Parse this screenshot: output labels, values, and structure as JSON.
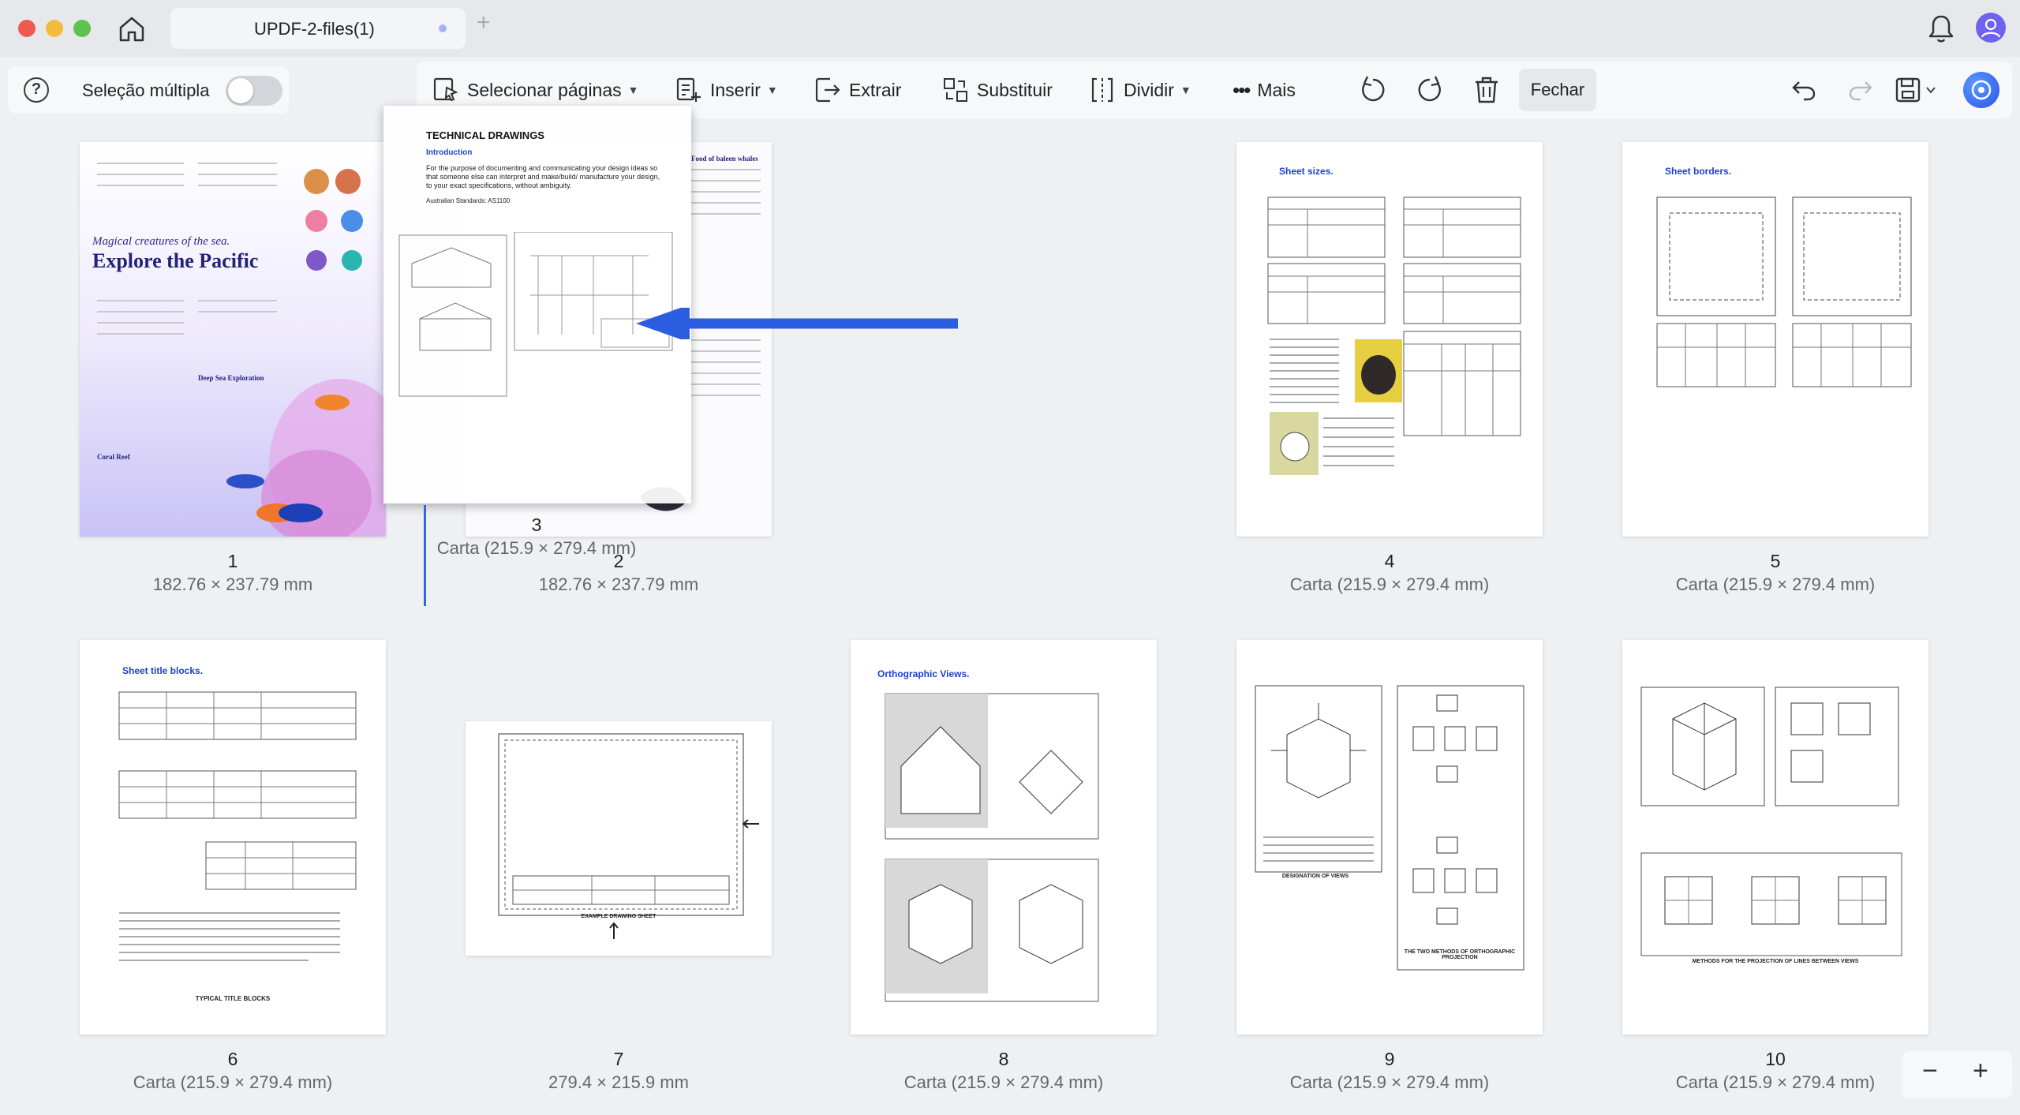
{
  "window": {
    "tab_title": "UPDF-2-files(1)",
    "tab_add": "+"
  },
  "left_panel": {
    "help": "?",
    "multi_select_label": "Seleção múltipla",
    "multi_select_on": false
  },
  "toolbar": {
    "select_pages": "Selecionar páginas",
    "insert": "Inserir",
    "extract": "Extrair",
    "replace": "Substituir",
    "split": "Dividir",
    "more": "Mais",
    "close": "Fechar"
  },
  "zoom": {
    "out": "−",
    "in": "+"
  },
  "pages": [
    {
      "num": "1",
      "size": "182.76 × 237.79 mm"
    },
    {
      "num": "2",
      "size": "182.76 × 237.79 mm"
    },
    {
      "num": "3",
      "size": "Carta (215.9 × 279.4 mm)"
    },
    {
      "num": "4",
      "size": "Carta (215.9 × 279.4 mm)"
    },
    {
      "num": "5",
      "size": "Carta (215.9 × 279.4 mm)"
    },
    {
      "num": "6",
      "size": "Carta (215.9 × 279.4 mm)"
    },
    {
      "num": "7",
      "size": "279.4 × 215.9 mm"
    },
    {
      "num": "8",
      "size": "Carta (215.9 × 279.4 mm)"
    },
    {
      "num": "9",
      "size": "Carta (215.9 × 279.4 mm)"
    },
    {
      "num": "10",
      "size": "Carta (215.9 × 279.4 mm)"
    }
  ],
  "page_content": {
    "p1_subtitle": "Magical creatures of the sea.",
    "p1_title": "Explore the Pacific",
    "p1_section1": "Deep Sea Exploration",
    "p1_section2": "Coral Reef",
    "p2_heading": "Food of baleen whales",
    "p3_title": "TECHNICAL DRAWINGS",
    "p3_intro": "Introduction",
    "p3_body": "For the purpose of documenting and communicating your design ideas so that someone else can interpret and make/build/ manufacture your design, to your exact specifications, without ambiguity.",
    "p3_standards": "Australian Standards:  AS1100",
    "p4_heading": "Sheet sizes.",
    "p5_heading": "Sheet borders.",
    "p6_heading": "Sheet title blocks.",
    "p6_caption": "TYPICAL TITLE BLOCKS",
    "p7_caption": "EXAMPLE DRAWING SHEET",
    "p8_heading": "Orthographic Views.",
    "p9_caption": "DESIGNATION OF VIEWS",
    "p9_caption2": "THE TWO METHODS OF ORTHOGRAPHIC PROJECTION",
    "p10_caption": "METHODS FOR THE PROJECTION OF LINES BETWEEN VIEWS"
  },
  "colors": {
    "accent": "#3466e0",
    "heading_blue": "#1c3fd0",
    "background": "#eef0f3"
  }
}
